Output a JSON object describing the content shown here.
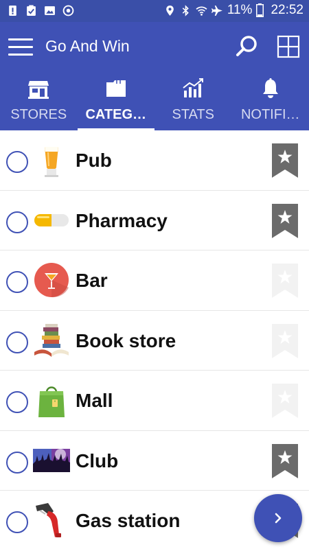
{
  "status_bar": {
    "battery_percent": "11%",
    "time": "22:52"
  },
  "toolbar": {
    "title": "Go And Win"
  },
  "tabs": [
    {
      "label": "STORES",
      "icon": "store-icon",
      "active": false
    },
    {
      "label": "CATEG…",
      "icon": "folder-icon",
      "active": true
    },
    {
      "label": "STATS",
      "icon": "stats-icon",
      "active": false
    },
    {
      "label": "NOTIFI…",
      "icon": "bell-icon",
      "active": false
    }
  ],
  "categories": [
    {
      "label": "Pub",
      "icon": "beer-icon",
      "bookmarked": true
    },
    {
      "label": "Pharmacy",
      "icon": "pill-icon",
      "bookmarked": true
    },
    {
      "label": "Bar",
      "icon": "cocktail-icon",
      "bookmarked": false
    },
    {
      "label": "Book store",
      "icon": "books-icon",
      "bookmarked": false
    },
    {
      "label": "Mall",
      "icon": "shopping-bag-icon",
      "bookmarked": false
    },
    {
      "label": "Club",
      "icon": "crowd-icon",
      "bookmarked": true
    },
    {
      "label": "Gas station",
      "icon": "fuel-nozzle-icon",
      "bookmarked": true
    }
  ],
  "colors": {
    "primary": "#3f51b5",
    "status_bar": "#3a4fa8",
    "bookmark_active": "#6b6b6b",
    "bookmark_inactive": "#f2f2f2"
  },
  "fab": {
    "icon": "chevron-right-icon"
  }
}
